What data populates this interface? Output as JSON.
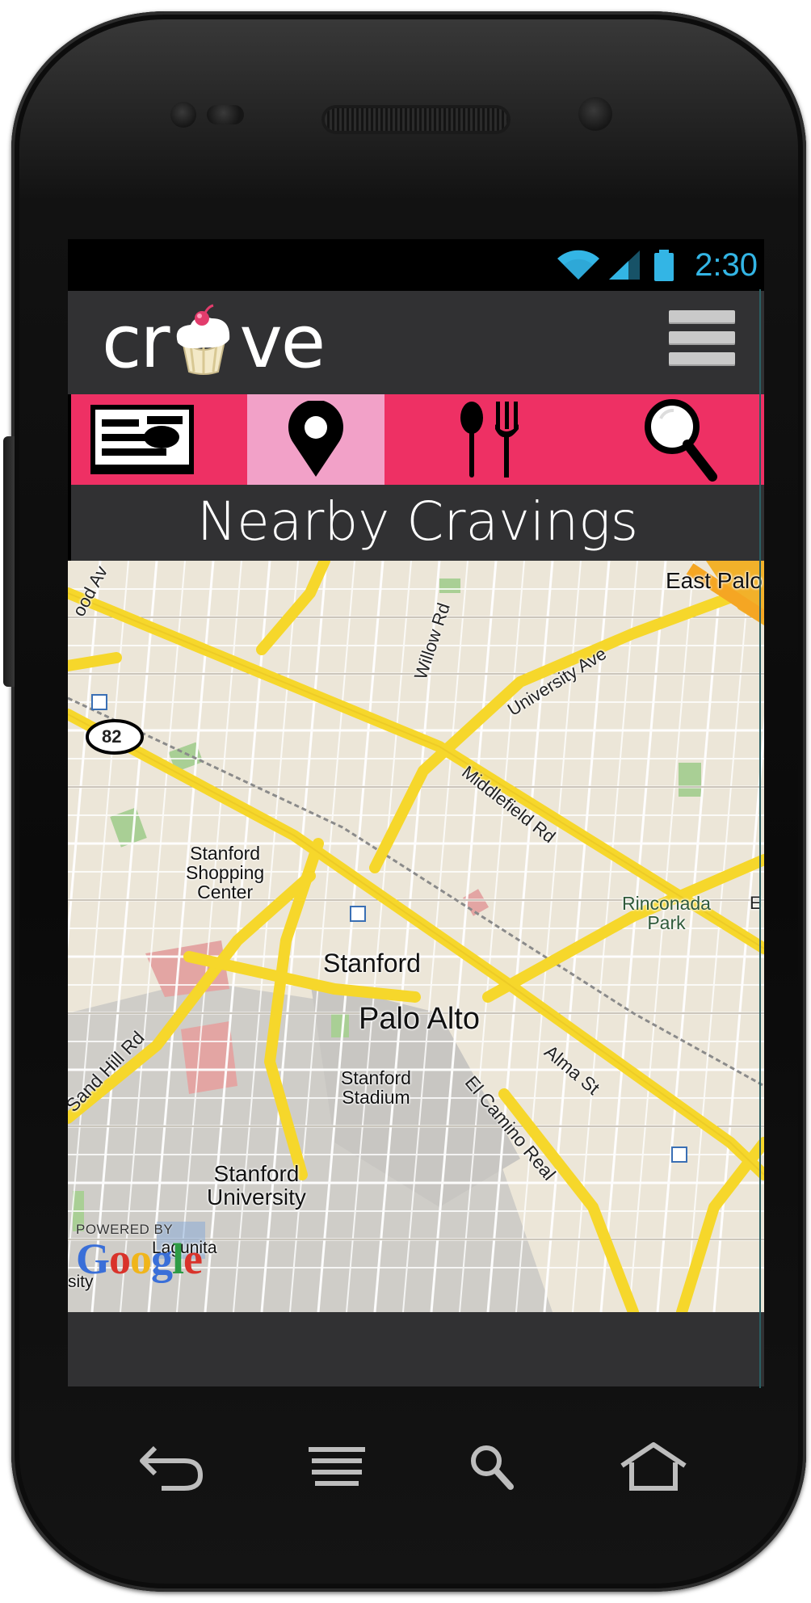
{
  "status_bar": {
    "time": "2:30",
    "icons": [
      "wifi-icon",
      "signal-icon",
      "battery-icon"
    ],
    "accent": "#33b5e5"
  },
  "app": {
    "logo_left": "cr",
    "logo_right": "ve",
    "menu_icon": "menu-list-icon",
    "bar_color": "#313133"
  },
  "tabs": [
    {
      "icon": "news-feed-icon",
      "active": false
    },
    {
      "icon": "map-pin-icon",
      "active": true
    },
    {
      "icon": "fork-spoon-icon",
      "active": false
    },
    {
      "icon": "magnifier-icon",
      "active": false
    }
  ],
  "tab_colors": {
    "bar": "#ee3064",
    "active": "#f2a1c8"
  },
  "screen_title": "Nearby Cravings",
  "map": {
    "labels": {
      "east_palo_alto": "East Palo Alt",
      "willow_rd": "Willow Rd",
      "university_ave": "University Ave",
      "middlefield_rd": "Middlefield Rd",
      "shopping_center_1": "Stanford",
      "shopping_center_2": "Shopping",
      "shopping_center_3": "Center",
      "rinconada_1": "Rinconada",
      "rinconada_2": "Park",
      "stanford": "Stanford",
      "palo_alto": "Palo Alto",
      "sand_hill_rd": "Sand Hill Rd",
      "alma_st": "Alma St",
      "el_camino_real": "El Camino Real",
      "stadium_1": "Stanford",
      "stadium_2": "Stadium",
      "university_1": "Stanford",
      "university_2": "University",
      "laguinita": "Lagunita",
      "ood_av": "ood Av",
      "route_82": "82",
      "east_edge": "E",
      "sity": "sity",
      "powered_by": "POWERED BY",
      "google": "Google"
    }
  },
  "nav_buttons": [
    "back-icon",
    "recent-apps-icon",
    "search-icon",
    "home-icon"
  ]
}
